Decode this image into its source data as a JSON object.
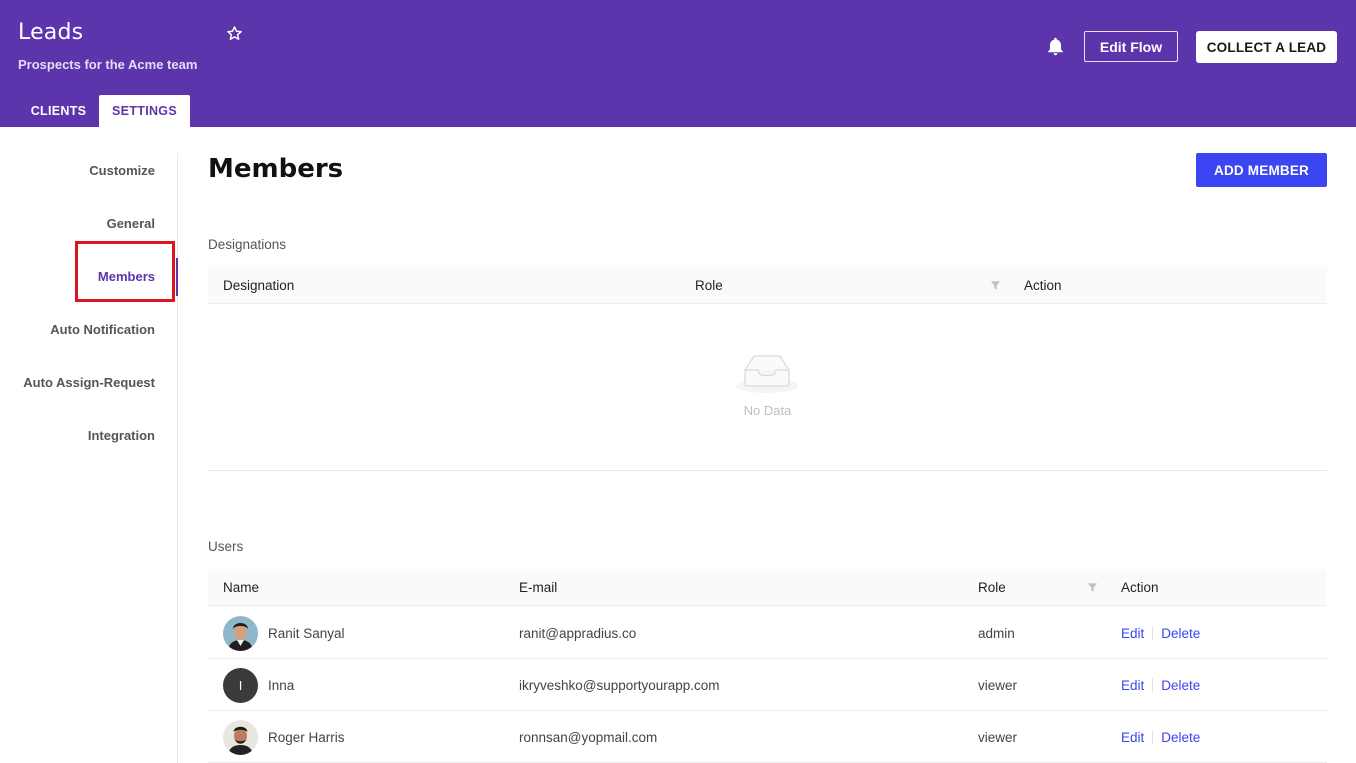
{
  "header": {
    "title": "Leads",
    "subtitle": "Prospects for the Acme team",
    "edit_flow_label": "Edit Flow",
    "collect_lead_label": "COLLECT A LEAD",
    "tabs": [
      {
        "label": "CLIENTS",
        "active": false
      },
      {
        "label": "SETTINGS",
        "active": true
      }
    ],
    "colors": {
      "brand": "#5c35ad",
      "primary_button": "#3b45f2"
    }
  },
  "sidebar": {
    "items": [
      {
        "label": "Customize",
        "active": false
      },
      {
        "label": "General",
        "active": false
      },
      {
        "label": "Members",
        "active": true
      },
      {
        "label": "Auto Notification",
        "active": false
      },
      {
        "label": "Auto Assign-Request",
        "active": false
      },
      {
        "label": "Integration",
        "active": false
      }
    ]
  },
  "main": {
    "title": "Members",
    "add_member_label": "ADD MEMBER",
    "designations": {
      "label": "Designations",
      "columns": [
        "Designation",
        "Role",
        "Action"
      ],
      "empty_text": "No Data"
    },
    "users": {
      "label": "Users",
      "columns": [
        "Name",
        "E-mail",
        "Role",
        "Action"
      ],
      "rows": [
        {
          "name": "Ranit Sanyal",
          "email": "ranit@appradius.co",
          "role": "admin",
          "edit": "Edit",
          "delete": "Delete",
          "avatar": "photo"
        },
        {
          "name": "Inna",
          "email": "ikryveshko@supportyourapp.com",
          "role": "viewer",
          "edit": "Edit",
          "delete": "Delete",
          "avatar": "letter",
          "avatar_letter": "I"
        },
        {
          "name": "Roger Harris",
          "email": "ronnsan@yopmail.com",
          "role": "viewer",
          "edit": "Edit",
          "delete": "Delete",
          "avatar": "photo"
        }
      ]
    }
  }
}
